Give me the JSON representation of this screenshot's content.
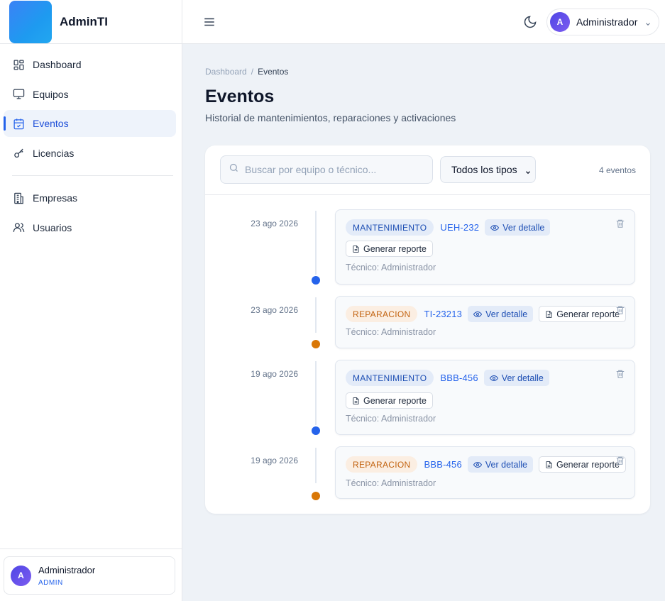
{
  "brand": {
    "name": "AdminTI"
  },
  "sidebar": {
    "items": [
      {
        "label": "Dashboard",
        "icon": "grid-icon"
      },
      {
        "label": "Equipos",
        "icon": "monitor-icon"
      },
      {
        "label": "Eventos",
        "icon": "calendar-check-icon",
        "active": true
      },
      {
        "label": "Licencias",
        "icon": "key-icon"
      },
      {
        "label": "Empresas",
        "icon": "building-icon"
      },
      {
        "label": "Usuarios",
        "icon": "users-icon"
      }
    ],
    "user": {
      "initial": "A",
      "name": "Administrador",
      "role": "ADMIN"
    }
  },
  "topbar": {
    "user_initial": "A",
    "user_name": "Administrador"
  },
  "breadcrumb": {
    "root": "Dashboard",
    "separator": "/",
    "current": "Eventos"
  },
  "page": {
    "title": "Eventos",
    "subtitle": "Historial de mantenimientos, reparaciones y activaciones"
  },
  "filters": {
    "search_placeholder": "Buscar por equipo o técnico...",
    "type_selected": "Todos los tipos",
    "count_label": "4 eventos"
  },
  "events": [
    {
      "date": "23 ago 2026",
      "type": "MANTENIMIENTO",
      "code": "UEH-232",
      "view_label": "Ver detalle",
      "report_label": "Generar reporte",
      "tech": "Técnico: Administrador",
      "color": "#2563eb"
    },
    {
      "date": "23 ago 2026",
      "type": "REPARACION",
      "code": "TI-23213",
      "view_label": "Ver detalle",
      "report_label": "Generar reporte",
      "tech": "Técnico: Administrador",
      "color": "#d97706"
    },
    {
      "date": "19 ago 2026",
      "type": "MANTENIMIENTO",
      "code": "BBB-456",
      "view_label": "Ver detalle",
      "report_label": "Generar reporte",
      "tech": "Técnico: Administrador",
      "color": "#2563eb"
    },
    {
      "date": "19 ago 2026",
      "type": "REPARACION",
      "code": "BBB-456",
      "view_label": "Ver detalle",
      "report_label": "Generar reporte",
      "tech": "Técnico: Administrador",
      "color": "#d97706"
    }
  ],
  "colors": {
    "accent": "#2563eb",
    "mantenimiento": "#2563eb",
    "reparacion": "#d97706"
  }
}
